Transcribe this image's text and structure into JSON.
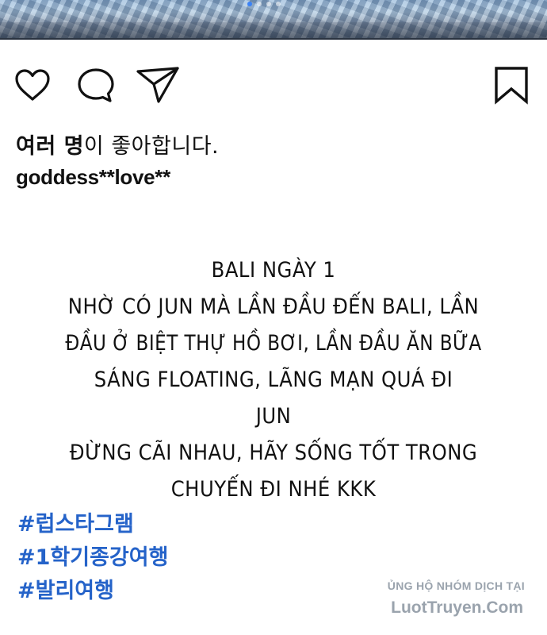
{
  "post": {
    "carousel": {
      "total": 4,
      "active_index": 0
    },
    "actions": {
      "like_icon": "heart-icon",
      "comment_icon": "comment-bubble-icon",
      "share_icon": "paper-plane-icon",
      "save_icon": "bookmark-icon"
    },
    "likes": {
      "bold": "여러 명",
      "rest": "이 좋아합니다."
    },
    "username": "goddess**love**",
    "caption_lines": [
      "BALI NGÀY 1",
      "NHỜ CÓ JUN MÀ LẦN ĐẦU ĐẾN BALI, LẦN",
      "ĐẦU Ở BIỆT THỰ HỒ BƠI, LẦN ĐẦU ĂN BỮA",
      "SÁNG FLOATING, LÃNG MẠN QUÁ ĐI",
      "JUN",
      "ĐỪNG CÃI NHAU, HÃY SỐNG TỐT TRONG",
      "CHUYẾN ĐI NHÉ KKK"
    ],
    "hashtags": [
      "#럽스타그램",
      "#1학기종강여행",
      "#발리여행"
    ]
  },
  "watermark": {
    "line1": "ỦNG HỘ NHÓM DỊCH TẠI",
    "line2": "LuotTruyen.Com"
  },
  "colors": {
    "hashtag": "#2563c9",
    "watermark": "#9aa3ad",
    "text": "#111111",
    "active_dot": "#3b82f6"
  }
}
